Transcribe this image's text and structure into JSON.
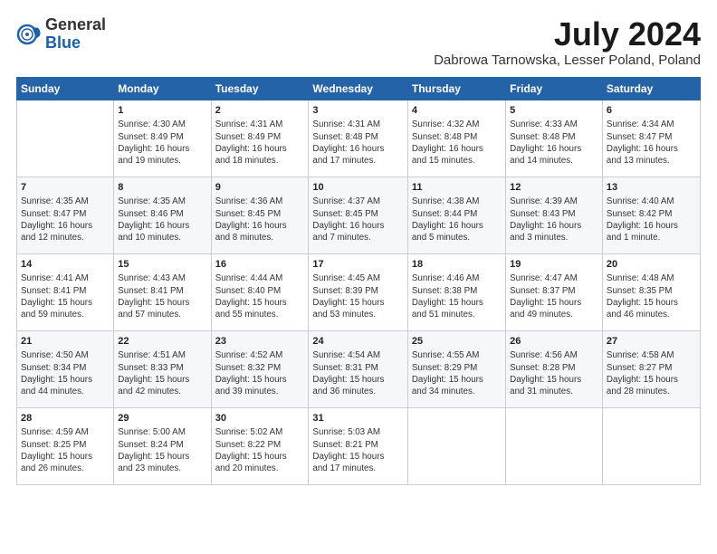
{
  "logo": {
    "general": "General",
    "blue": "Blue"
  },
  "title": "July 2024",
  "location": "Dabrowa Tarnowska, Lesser Poland, Poland",
  "headers": [
    "Sunday",
    "Monday",
    "Tuesday",
    "Wednesday",
    "Thursday",
    "Friday",
    "Saturday"
  ],
  "weeks": [
    [
      {
        "day": "",
        "text": ""
      },
      {
        "day": "1",
        "text": "Sunrise: 4:30 AM\nSunset: 8:49 PM\nDaylight: 16 hours\nand 19 minutes."
      },
      {
        "day": "2",
        "text": "Sunrise: 4:31 AM\nSunset: 8:49 PM\nDaylight: 16 hours\nand 18 minutes."
      },
      {
        "day": "3",
        "text": "Sunrise: 4:31 AM\nSunset: 8:48 PM\nDaylight: 16 hours\nand 17 minutes."
      },
      {
        "day": "4",
        "text": "Sunrise: 4:32 AM\nSunset: 8:48 PM\nDaylight: 16 hours\nand 15 minutes."
      },
      {
        "day": "5",
        "text": "Sunrise: 4:33 AM\nSunset: 8:48 PM\nDaylight: 16 hours\nand 14 minutes."
      },
      {
        "day": "6",
        "text": "Sunrise: 4:34 AM\nSunset: 8:47 PM\nDaylight: 16 hours\nand 13 minutes."
      }
    ],
    [
      {
        "day": "7",
        "text": "Sunrise: 4:35 AM\nSunset: 8:47 PM\nDaylight: 16 hours\nand 12 minutes."
      },
      {
        "day": "8",
        "text": "Sunrise: 4:35 AM\nSunset: 8:46 PM\nDaylight: 16 hours\nand 10 minutes."
      },
      {
        "day": "9",
        "text": "Sunrise: 4:36 AM\nSunset: 8:45 PM\nDaylight: 16 hours\nand 8 minutes."
      },
      {
        "day": "10",
        "text": "Sunrise: 4:37 AM\nSunset: 8:45 PM\nDaylight: 16 hours\nand 7 minutes."
      },
      {
        "day": "11",
        "text": "Sunrise: 4:38 AM\nSunset: 8:44 PM\nDaylight: 16 hours\nand 5 minutes."
      },
      {
        "day": "12",
        "text": "Sunrise: 4:39 AM\nSunset: 8:43 PM\nDaylight: 16 hours\nand 3 minutes."
      },
      {
        "day": "13",
        "text": "Sunrise: 4:40 AM\nSunset: 8:42 PM\nDaylight: 16 hours\nand 1 minute."
      }
    ],
    [
      {
        "day": "14",
        "text": "Sunrise: 4:41 AM\nSunset: 8:41 PM\nDaylight: 15 hours\nand 59 minutes."
      },
      {
        "day": "15",
        "text": "Sunrise: 4:43 AM\nSunset: 8:41 PM\nDaylight: 15 hours\nand 57 minutes."
      },
      {
        "day": "16",
        "text": "Sunrise: 4:44 AM\nSunset: 8:40 PM\nDaylight: 15 hours\nand 55 minutes."
      },
      {
        "day": "17",
        "text": "Sunrise: 4:45 AM\nSunset: 8:39 PM\nDaylight: 15 hours\nand 53 minutes."
      },
      {
        "day": "18",
        "text": "Sunrise: 4:46 AM\nSunset: 8:38 PM\nDaylight: 15 hours\nand 51 minutes."
      },
      {
        "day": "19",
        "text": "Sunrise: 4:47 AM\nSunset: 8:37 PM\nDaylight: 15 hours\nand 49 minutes."
      },
      {
        "day": "20",
        "text": "Sunrise: 4:48 AM\nSunset: 8:35 PM\nDaylight: 15 hours\nand 46 minutes."
      }
    ],
    [
      {
        "day": "21",
        "text": "Sunrise: 4:50 AM\nSunset: 8:34 PM\nDaylight: 15 hours\nand 44 minutes."
      },
      {
        "day": "22",
        "text": "Sunrise: 4:51 AM\nSunset: 8:33 PM\nDaylight: 15 hours\nand 42 minutes."
      },
      {
        "day": "23",
        "text": "Sunrise: 4:52 AM\nSunset: 8:32 PM\nDaylight: 15 hours\nand 39 minutes."
      },
      {
        "day": "24",
        "text": "Sunrise: 4:54 AM\nSunset: 8:31 PM\nDaylight: 15 hours\nand 36 minutes."
      },
      {
        "day": "25",
        "text": "Sunrise: 4:55 AM\nSunset: 8:29 PM\nDaylight: 15 hours\nand 34 minutes."
      },
      {
        "day": "26",
        "text": "Sunrise: 4:56 AM\nSunset: 8:28 PM\nDaylight: 15 hours\nand 31 minutes."
      },
      {
        "day": "27",
        "text": "Sunrise: 4:58 AM\nSunset: 8:27 PM\nDaylight: 15 hours\nand 28 minutes."
      }
    ],
    [
      {
        "day": "28",
        "text": "Sunrise: 4:59 AM\nSunset: 8:25 PM\nDaylight: 15 hours\nand 26 minutes."
      },
      {
        "day": "29",
        "text": "Sunrise: 5:00 AM\nSunset: 8:24 PM\nDaylight: 15 hours\nand 23 minutes."
      },
      {
        "day": "30",
        "text": "Sunrise: 5:02 AM\nSunset: 8:22 PM\nDaylight: 15 hours\nand 20 minutes."
      },
      {
        "day": "31",
        "text": "Sunrise: 5:03 AM\nSunset: 8:21 PM\nDaylight: 15 hours\nand 17 minutes."
      },
      {
        "day": "",
        "text": ""
      },
      {
        "day": "",
        "text": ""
      },
      {
        "day": "",
        "text": ""
      }
    ]
  ]
}
